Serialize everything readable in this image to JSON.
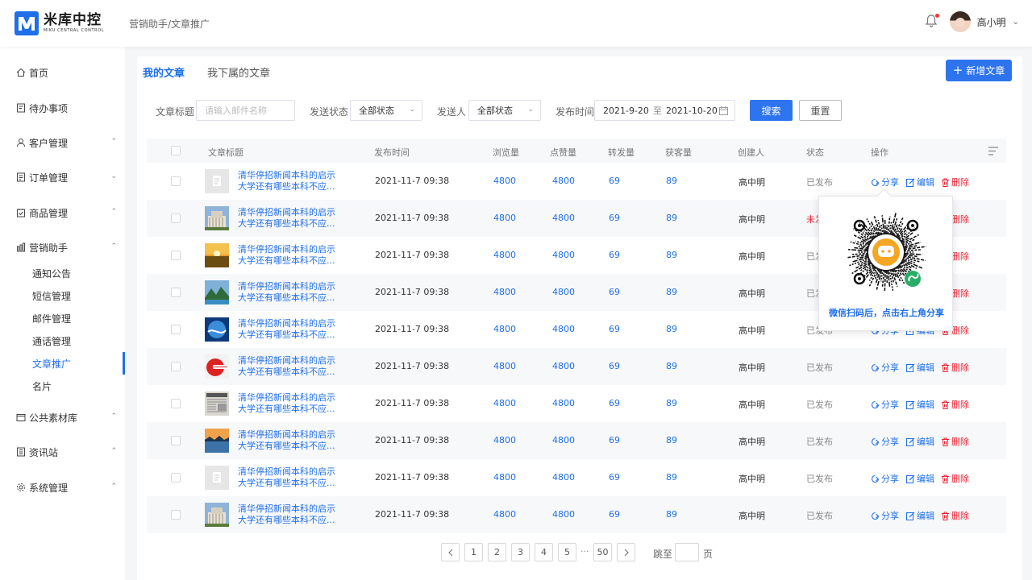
{
  "app": {
    "name_cn": "米库中控",
    "name_en": "MIKU CENTRAL CONTROL",
    "brand_color": "#1e6fe8"
  },
  "header": {
    "breadcrumb": "营销助手/文章推广",
    "user": "高小明"
  },
  "sidebar": {
    "items": [
      {
        "label": "首页",
        "icon": "home-icon"
      },
      {
        "label": "待办事项",
        "icon": "todo-icon"
      },
      {
        "label": "客户管理",
        "icon": "user-icon"
      },
      {
        "label": "订单管理",
        "icon": "order-icon"
      },
      {
        "label": "商品管理",
        "icon": "goods-icon"
      },
      {
        "label": "营销助手",
        "icon": "marketing-icon"
      },
      {
        "label": "公共素材库",
        "icon": "material-icon"
      },
      {
        "label": "资讯站",
        "icon": "news-icon"
      },
      {
        "label": "系统管理",
        "icon": "settings-icon"
      }
    ],
    "sub_items": [
      "通知公告",
      "短信管理",
      "邮件管理",
      "通话管理",
      "文章推广",
      "名片"
    ],
    "active_sub": "文章推广"
  },
  "tabs": [
    "我的文章",
    "我下属的文章"
  ],
  "new_button": "新增文章",
  "filters": {
    "title_label": "文章标题",
    "title_placeholder": "请输入邮件名称",
    "status_label": "发送状态",
    "status_value": "全部状态",
    "sender_label": "发送人",
    "sender_value": "全部状态",
    "time_label": "发布时间",
    "date_from": "2021-9-20",
    "date_sep": "至",
    "date_to": "2021-10-20",
    "search": "搜索",
    "reset": "重置"
  },
  "table": {
    "headers": [
      "文章标题",
      "发布时间",
      "浏览量",
      "点赞量",
      "转发量",
      "获客量",
      "创建人",
      "状态",
      "操作"
    ],
    "rows": [
      {
        "title_line1": "清华停招新闻本科的启示",
        "title_line2": "大学还有哪些本科不应...",
        "time": "2021-11-7 09:38",
        "views": "4800",
        "likes": "4800",
        "shares": "69",
        "leads": "89",
        "creator": "高中明",
        "status": "已发布",
        "thumb": "placeholder"
      },
      {
        "title_line1": "清华停招新闻本科的启示",
        "title_line2": "大学还有哪些本科不应...",
        "time": "2021-11-7 09:38",
        "views": "4800",
        "likes": "4800",
        "shares": "69",
        "leads": "89",
        "creator": "高中明",
        "status": "未发布",
        "thumb": "building"
      },
      {
        "title_line1": "清华停招新闻本科的启示",
        "title_line2": "大学还有哪些本科不应...",
        "time": "2021-11-7 09:38",
        "views": "4800",
        "likes": "4800",
        "shares": "69",
        "leads": "89",
        "creator": "高中明",
        "status": "已发布",
        "thumb": "sunset"
      },
      {
        "title_line1": "清华停招新闻本科的启示",
        "title_line2": "大学还有哪些本科不应...",
        "time": "2021-11-7 09:38",
        "views": "4800",
        "likes": "4800",
        "shares": "69",
        "leads": "89",
        "creator": "高中明",
        "status": "已发布",
        "thumb": "mountain"
      },
      {
        "title_line1": "清华停招新闻本科的启示",
        "title_line2": "大学还有哪些本科不应...",
        "time": "2021-11-7 09:38",
        "views": "4800",
        "likes": "4800",
        "shares": "69",
        "leads": "89",
        "creator": "高中明",
        "status": "已发布",
        "thumb": "globe"
      },
      {
        "title_line1": "清华停招新闻本科的启示",
        "title_line2": "大学还有哪些本科不应...",
        "time": "2021-11-7 09:38",
        "views": "4800",
        "likes": "4800",
        "shares": "69",
        "leads": "89",
        "creator": "高中明",
        "status": "已发布",
        "thumb": "news-red"
      },
      {
        "title_line1": "清华停招新闻本科的启示",
        "title_line2": "大学还有哪些本科不应...",
        "time": "2021-11-7 09:38",
        "views": "4800",
        "likes": "4800",
        "shares": "69",
        "leads": "89",
        "creator": "高中明",
        "status": "已发布",
        "thumb": "newspaper"
      },
      {
        "title_line1": "清华停招新闻本科的启示",
        "title_line2": "大学还有哪些本科不应...",
        "time": "2021-11-7 09:38",
        "views": "4800",
        "likes": "4800",
        "shares": "69",
        "leads": "89",
        "creator": "高中明",
        "status": "已发布",
        "thumb": "lake"
      },
      {
        "title_line1": "清华停招新闻本科的启示",
        "title_line2": "大学还有哪些本科不应...",
        "time": "2021-11-7 09:38",
        "views": "4800",
        "likes": "4800",
        "shares": "69",
        "leads": "89",
        "creator": "高中明",
        "status": "已发布",
        "thumb": "placeholder"
      },
      {
        "title_line1": "清华停招新闻本科的启示",
        "title_line2": "大学还有哪些本科不应...",
        "time": "2021-11-7 09:38",
        "views": "4800",
        "likes": "4800",
        "shares": "69",
        "leads": "89",
        "creator": "高中明",
        "status": "已发布",
        "thumb": "building"
      }
    ],
    "ops": {
      "share": "分享",
      "edit": "编辑",
      "delete": "删除"
    }
  },
  "popover": {
    "text": "微信扫码后，点击右上角分享"
  },
  "pagination": {
    "pages": [
      "1",
      "2",
      "3",
      "4",
      "5"
    ],
    "dots": "···",
    "last": "50",
    "jump_label": "跳至",
    "page_suffix": "页"
  }
}
